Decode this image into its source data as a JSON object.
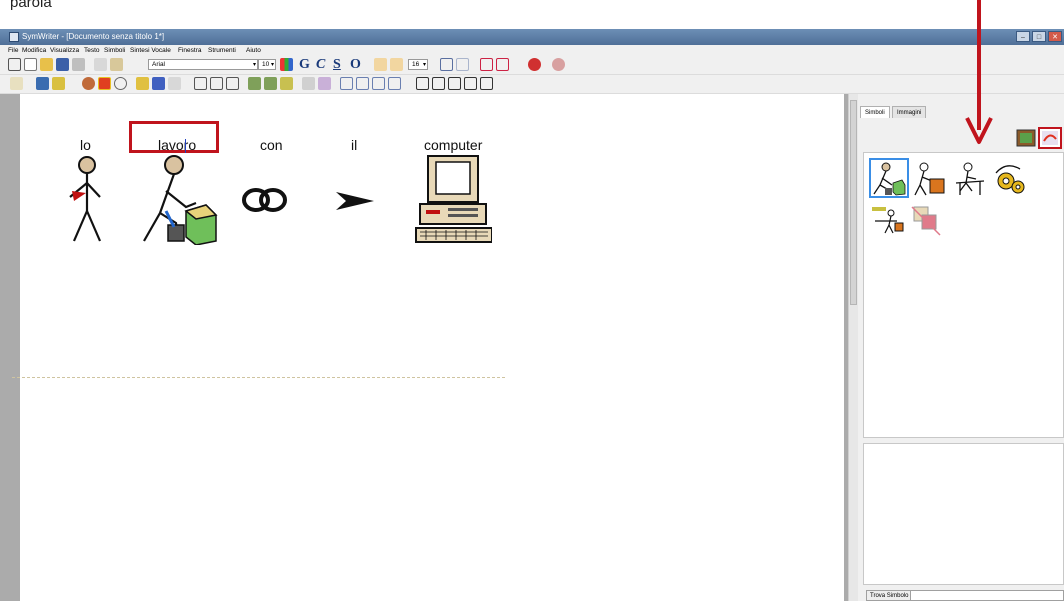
{
  "caption": "parola",
  "window": {
    "title": "SymWriter - [Documento senza titolo 1*]"
  },
  "menu": [
    "File",
    "Modifica",
    "Visualizza",
    "Testo",
    "Simboli",
    "Sintesi Vocale",
    "Finestra",
    "Strumenti",
    "Aiuto"
  ],
  "toolbar": {
    "font": "Arial",
    "size": "10",
    "spacing": "16"
  },
  "document": {
    "words": [
      "lo",
      "lavoro",
      "con",
      "il",
      "computer"
    ]
  },
  "panel": {
    "tabs": [
      "Simboli",
      "Immagini"
    ],
    "find_button": "Trova Simbolo"
  },
  "colors": {
    "highlight": "#c0141d",
    "arrow": "#c0141d",
    "titlebar": "#5b7ba3"
  }
}
